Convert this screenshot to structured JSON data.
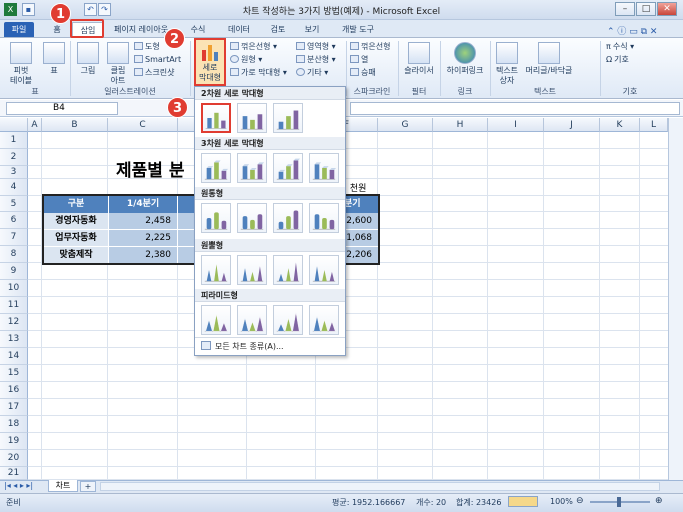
{
  "window": {
    "title": "차트 작성하는 3가지 방법(예제) - Microsoft Excel"
  },
  "tabs": [
    "파일",
    "홈",
    "삽입",
    "페이지 레이아웃",
    "수식",
    "데이터",
    "검토",
    "보기",
    "개발 도구"
  ],
  "ribbon": {
    "pivot": "피벗\n테이블",
    "table": "표",
    "picture": "그림",
    "clipart": "클립\n아트",
    "shapes": "도형",
    "smartart": "SmartArt",
    "screenshot": "스크린샷",
    "column_chart": "세로\n막대형",
    "line": "꺾은선형",
    "pie": "원형",
    "bar": "가로 막대형",
    "area": "영역형",
    "scatter": "분산형",
    "other": "기타",
    "spark_line": "꺾은선형",
    "spark_column": "열",
    "spark_winloss": "승패",
    "slicer": "슬라이서",
    "hyperlink": "하이퍼링크",
    "textbox": "텍스트\n상자",
    "header_footer": "머리글/바닥글",
    "equation": "수식",
    "symbol": "기호",
    "groups": {
      "tables": "표",
      "illustrations": "일러스트레이션",
      "sparklines": "스파크라인",
      "filter": "필터",
      "links": "링크",
      "text": "텍스트",
      "symbols": "기호"
    }
  },
  "formula_bar": {
    "name_box": "B4",
    "fx": "fx"
  },
  "columns": [
    "A",
    "B",
    "C",
    "D",
    "E",
    "F",
    "G",
    "H",
    "I",
    "J",
    "K",
    "L"
  ],
  "rows": [
    "1",
    "2",
    "3",
    "4",
    "5",
    "6",
    "7",
    "8",
    "9",
    "10",
    "11",
    "12",
    "13",
    "14",
    "15",
    "16",
    "17",
    "18",
    "19",
    "20",
    "21"
  ],
  "sheet": {
    "title": "제품별 분",
    "unit": ": 천원",
    "header": [
      "구분",
      "1/4분기",
      "분기"
    ],
    "data": [
      {
        "name": "경영자동화",
        "q1": "2,458",
        "q4": "2,600"
      },
      {
        "name": "업무자동화",
        "q1": "2,225",
        "q4": "1,068"
      },
      {
        "name": "맞춤제작",
        "q1": "2,380",
        "q4": "2,206"
      }
    ]
  },
  "dropdown": {
    "sections": [
      "2차원 세로 막대형",
      "3차원 세로 막대형",
      "원통형",
      "원뿔형",
      "피라미드형"
    ],
    "all_charts": "모든 차트 종류(A)..."
  },
  "markers": [
    "1",
    "2",
    "3"
  ],
  "sheet_tabs": [
    "차트"
  ],
  "status": {
    "ready": "준비",
    "average": "평균: 1952.166667",
    "count": "개수: 20",
    "sum": "합계: 23426",
    "zoom": "100%"
  },
  "colors": {
    "accent": "#e03c31",
    "header_fill": "#4f81bd",
    "name_fill": "#dbe5f1",
    "num_fill": "#b8cce4"
  }
}
